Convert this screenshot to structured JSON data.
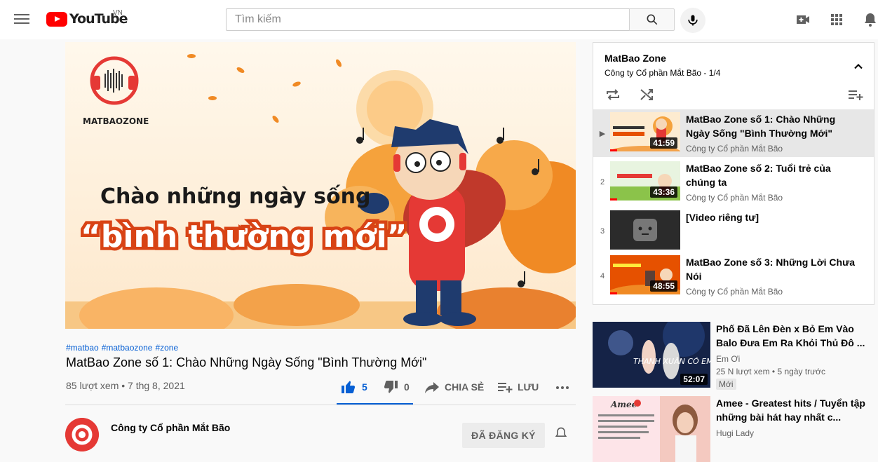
{
  "header": {
    "logo_text": "YouTube",
    "country": "VN",
    "search_placeholder": "Tìm kiếm"
  },
  "video": {
    "hashtags": [
      "#matbao",
      "#matbaozone",
      "#zone"
    ],
    "title": "MatBao Zone số 1: Chào Những Ngày Sống \"Bình Thường Mới\"",
    "meta": "85 lượt xem • 7 thg 8, 2021",
    "thumbnail_text_line1": "Chào những ngày sống",
    "thumbnail_text_line2": "“bình thường mới”",
    "likes": "5",
    "dislikes": "0",
    "share_label": "CHIA SẺ",
    "save_label": "LƯU",
    "channel": "Công ty Cổ phần Mắt Bão",
    "subscribe_label": "ĐÃ ĐĂNG KÝ",
    "brand_logo_text": "MATBAOZONE"
  },
  "playlist": {
    "title": "MatBao Zone",
    "subtitle": "Công ty Cổ phần Mắt Bão - 1/4",
    "items": [
      {
        "index": "▶",
        "title": "MatBao Zone số 1: Chào Những Ngày Sống \"Bình Thường Mới\"",
        "channel": "Công ty Cổ phần Mắt Bão",
        "duration": "41:59",
        "progress": 0.1
      },
      {
        "index": "2",
        "title": "MatBao Zone số 2: Tuổi trẻ của chúng ta",
        "channel": "Công ty Cổ phần Mắt Bão",
        "duration": "43:36",
        "progress": 0.1
      },
      {
        "index": "3",
        "title": "[Video riêng tư]",
        "channel": "",
        "duration": "",
        "progress": 0
      },
      {
        "index": "4",
        "title": "MatBao Zone số 3: Những Lời Chưa Nói",
        "channel": "Công ty Cổ phần Mắt Bão",
        "duration": "48:55",
        "progress": 0.1
      }
    ]
  },
  "recommendations": [
    {
      "title": "Phố Đã Lên Đèn x Bỏ Em Vào Balo Đưa Em Ra Khỏi Thủ Đô ...",
      "channel": "Em Ơi",
      "meta": "25 N lượt xem • 5 ngày trước",
      "badge": "Mới",
      "duration": "52:07",
      "thumb_text": "THANH XUÂN CÓ EM"
    },
    {
      "title": "Amee - Greatest hits / Tuyển tập những bài hát hay nhất c...",
      "channel": "Hugi Lady",
      "meta": "",
      "badge": "",
      "duration": "",
      "thumb_text": "Amee"
    }
  ],
  "colors": {
    "brand_red": "#ff0000",
    "link_blue": "#065fd4",
    "thumb_orange": "#f59a3a"
  }
}
